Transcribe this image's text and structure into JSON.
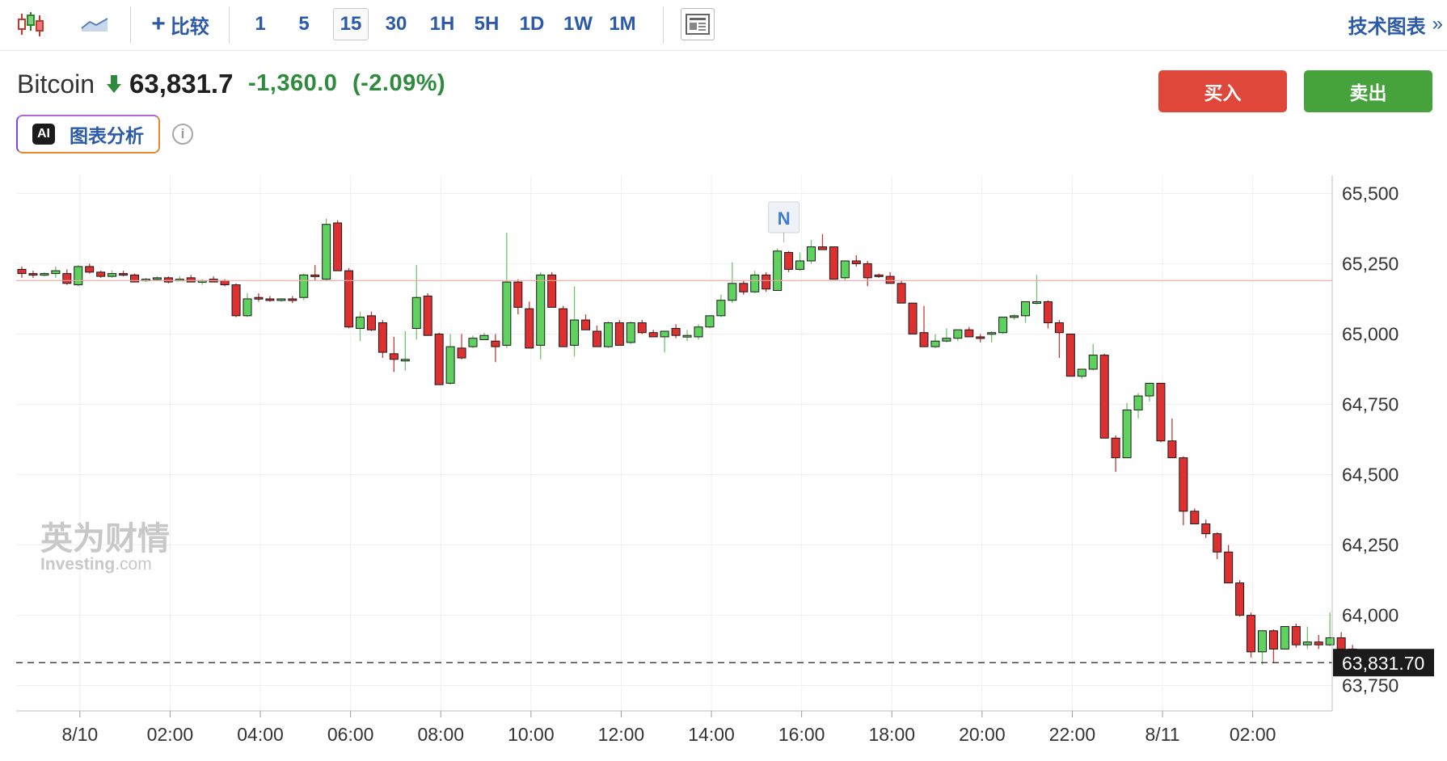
{
  "toolbar": {
    "compare_label": "比较",
    "intervals": [
      {
        "label": "1",
        "selected": false
      },
      {
        "label": "5",
        "selected": false
      },
      {
        "label": "15",
        "selected": true
      },
      {
        "label": "30",
        "selected": false
      },
      {
        "label": "1H",
        "selected": false
      },
      {
        "label": "5H",
        "selected": false
      },
      {
        "label": "1D",
        "selected": false
      },
      {
        "label": "1W",
        "selected": false
      },
      {
        "label": "1M",
        "selected": false
      }
    ],
    "tech_chart_label": "技术图表",
    "tech_chart_arrow": "»"
  },
  "header": {
    "name": "Bitcoin",
    "price": "63,831.7",
    "change": "-1,360.0",
    "change_pct": "(-2.09%)",
    "buy_label": "买入",
    "sell_label": "卖出",
    "ai_badge": "AI",
    "ai_label": "图表分析",
    "info_glyph": "i"
  },
  "colors": {
    "up": "#5ed15e",
    "down": "#dd3030",
    "accent": "#2a5aa8",
    "buy": "#e0473b",
    "sell": "#46a23a",
    "change": "#2e8b3d"
  },
  "watermark": {
    "cn": "英为财情",
    "en": "Investing",
    "dot": ".com"
  },
  "chart_data": {
    "type": "candlestick",
    "interval": "15",
    "y_ticks": [
      "65,500",
      "65,250",
      "65,000",
      "64,750",
      "64,500",
      "64,250",
      "64,000",
      "63,750"
    ],
    "y_tick_values": [
      65500,
      65250,
      65000,
      64750,
      64500,
      64250,
      64000,
      63750
    ],
    "ylim": [
      63660,
      65550
    ],
    "x_ticks": [
      "8/10",
      "02:00",
      "04:00",
      "06:00",
      "08:00",
      "10:00",
      "12:00",
      "14:00",
      "16:00",
      "18:00",
      "20:00",
      "22:00",
      "8/11",
      "02:00"
    ],
    "x_tick_index": [
      3,
      11,
      19,
      27,
      35,
      43,
      51,
      59,
      67,
      75,
      83,
      91,
      99,
      107
    ],
    "current_price_label": "63,831.70",
    "current_price": 63831.7,
    "reference_line": 65190,
    "news_marker": {
      "label": "N",
      "index": 67
    },
    "candles": [
      [
        65230,
        65240,
        65200,
        65215
      ],
      [
        65215,
        65225,
        65200,
        65210
      ],
      [
        65210,
        65220,
        65205,
        65215
      ],
      [
        65215,
        65240,
        65200,
        65225
      ],
      [
        65215,
        65230,
        65175,
        65180
      ],
      [
        65175,
        65245,
        65170,
        65240
      ],
      [
        65240,
        65250,
        65215,
        65220
      ],
      [
        65220,
        65225,
        65200,
        65205
      ],
      [
        65205,
        65225,
        65200,
        65215
      ],
      [
        65215,
        65225,
        65205,
        65210
      ],
      [
        65210,
        65215,
        65185,
        65185
      ],
      [
        65190,
        65200,
        65185,
        65195
      ],
      [
        65195,
        65205,
        65190,
        65200
      ],
      [
        65200,
        65205,
        65180,
        65185
      ],
      [
        65195,
        65205,
        65190,
        65195
      ],
      [
        65200,
        65210,
        65190,
        65185
      ],
      [
        65185,
        65195,
        65175,
        65190
      ],
      [
        65195,
        65205,
        65185,
        65185
      ],
      [
        65190,
        65195,
        65170,
        65175
      ],
      [
        65175,
        65180,
        65060,
        65065
      ],
      [
        65065,
        65145,
        65060,
        65125
      ],
      [
        65130,
        65145,
        65115,
        65125
      ],
      [
        65125,
        65135,
        65115,
        65120
      ],
      [
        65120,
        65125,
        65115,
        65125
      ],
      [
        65125,
        65135,
        65110,
        65120
      ],
      [
        65130,
        65215,
        65120,
        65210
      ],
      [
        65210,
        65245,
        65190,
        65205
      ],
      [
        65195,
        65410,
        65190,
        65390
      ],
      [
        65395,
        65405,
        65230,
        65225
      ],
      [
        65225,
        65235,
        65020,
        65025
      ],
      [
        65020,
        65080,
        64975,
        65060
      ],
      [
        65065,
        65080,
        65010,
        65015
      ],
      [
        65040,
        65050,
        64915,
        64935
      ],
      [
        64930,
        64990,
        64865,
        64910
      ],
      [
        64910,
        65010,
        64870,
        64910
      ],
      [
        65020,
        65245,
        64980,
        65130
      ],
      [
        65135,
        65145,
        64995,
        64995
      ],
      [
        65000,
        65005,
        64820,
        64820
      ],
      [
        64825,
        65000,
        64820,
        64955
      ],
      [
        64950,
        65000,
        64910,
        64915
      ],
      [
        64955,
        64995,
        64950,
        64985
      ],
      [
        64980,
        65005,
        64980,
        64995
      ],
      [
        64975,
        65000,
        64900,
        64955
      ],
      [
        64960,
        65360,
        64950,
        65185
      ],
      [
        65185,
        65195,
        65070,
        65095
      ],
      [
        65090,
        65115,
        64990,
        64950
      ],
      [
        64960,
        65220,
        64910,
        65210
      ],
      [
        65210,
        65220,
        65110,
        65095
      ],
      [
        65090,
        65100,
        64985,
        64955
      ],
      [
        64960,
        65170,
        64920,
        65050
      ],
      [
        65050,
        65070,
        65020,
        65015
      ],
      [
        65010,
        65030,
        64985,
        64955
      ],
      [
        64955,
        65045,
        64950,
        65040
      ],
      [
        65040,
        65050,
        64960,
        64960
      ],
      [
        64970,
        65045,
        64965,
        65040
      ],
      [
        65040,
        65050,
        65000,
        65005
      ],
      [
        65005,
        65015,
        64990,
        64990
      ],
      [
        64990,
        65000,
        64935,
        65010
      ],
      [
        65020,
        65035,
        64985,
        64995
      ],
      [
        64990,
        65015,
        64975,
        64995
      ],
      [
        64990,
        65035,
        64980,
        65025
      ],
      [
        65025,
        65065,
        65020,
        65065
      ],
      [
        65065,
        65140,
        65060,
        65120
      ],
      [
        65120,
        65255,
        65110,
        65180
      ],
      [
        65180,
        65190,
        65140,
        65150
      ],
      [
        65150,
        65225,
        65145,
        65210
      ],
      [
        65210,
        65220,
        65150,
        65160
      ],
      [
        65155,
        65305,
        65155,
        65295
      ],
      [
        65290,
        65295,
        65220,
        65230
      ],
      [
        65230,
        65290,
        65225,
        65260
      ],
      [
        65260,
        65335,
        65250,
        65310
      ],
      [
        65310,
        65355,
        65300,
        65300
      ],
      [
        65310,
        65310,
        65200,
        65195
      ],
      [
        65200,
        65260,
        65190,
        65260
      ],
      [
        65260,
        65280,
        65240,
        65250
      ],
      [
        65250,
        65260,
        65170,
        65200
      ],
      [
        65210,
        65215,
        65200,
        65205
      ],
      [
        65205,
        65220,
        65190,
        65180
      ],
      [
        65180,
        65190,
        65110,
        65110
      ],
      [
        65110,
        65110,
        65000,
        65000
      ],
      [
        65005,
        65100,
        64960,
        64955
      ],
      [
        64955,
        65000,
        64950,
        64975
      ],
      [
        64975,
        65020,
        64970,
        64985
      ],
      [
        64985,
        65000,
        64975,
        65015
      ],
      [
        65015,
        65025,
        64990,
        64990
      ],
      [
        64990,
        65000,
        64970,
        64985
      ],
      [
        65005,
        65010,
        64970,
        65005
      ],
      [
        65005,
        65060,
        65000,
        65060
      ],
      [
        65060,
        65070,
        65050,
        65065
      ],
      [
        65065,
        65080,
        65040,
        65115
      ],
      [
        65115,
        65210,
        65105,
        65115
      ],
      [
        65115,
        65120,
        65020,
        65040
      ],
      [
        65040,
        65050,
        64915,
        65005
      ],
      [
        65000,
        65000,
        64850,
        64850
      ],
      [
        64850,
        64870,
        64840,
        64875
      ],
      [
        64875,
        64965,
        64870,
        64925
      ],
      [
        64925,
        64930,
        64630,
        64630
      ],
      [
        64630,
        64640,
        64510,
        64560
      ],
      [
        64560,
        64755,
        64560,
        64730
      ],
      [
        64730,
        64790,
        64700,
        64780
      ],
      [
        64780,
        64825,
        64760,
        64825
      ],
      [
        64825,
        64820,
        64615,
        64620
      ],
      [
        64620,
        64700,
        64560,
        64560
      ],
      [
        64560,
        64565,
        64320,
        64370
      ],
      [
        64370,
        64380,
        64325,
        64325
      ],
      [
        64325,
        64340,
        64275,
        64290
      ],
      [
        64290,
        64295,
        64200,
        64225
      ],
      [
        64225,
        64250,
        64115,
        64115
      ],
      [
        64115,
        64125,
        63995,
        64000
      ],
      [
        64000,
        64010,
        63850,
        63870
      ],
      [
        63870,
        63900,
        63825,
        63945
      ],
      [
        63945,
        63950,
        63830,
        63880
      ],
      [
        63880,
        63950,
        63880,
        63960
      ],
      [
        63960,
        63970,
        63885,
        63895
      ],
      [
        63895,
        63960,
        63880,
        63905
      ],
      [
        63905,
        63930,
        63880,
        63895
      ],
      [
        63895,
        64010,
        63890,
        63920
      ],
      [
        63920,
        63940,
        63870,
        63880
      ],
      [
        63880,
        63895,
        63800,
        63832
      ]
    ]
  }
}
